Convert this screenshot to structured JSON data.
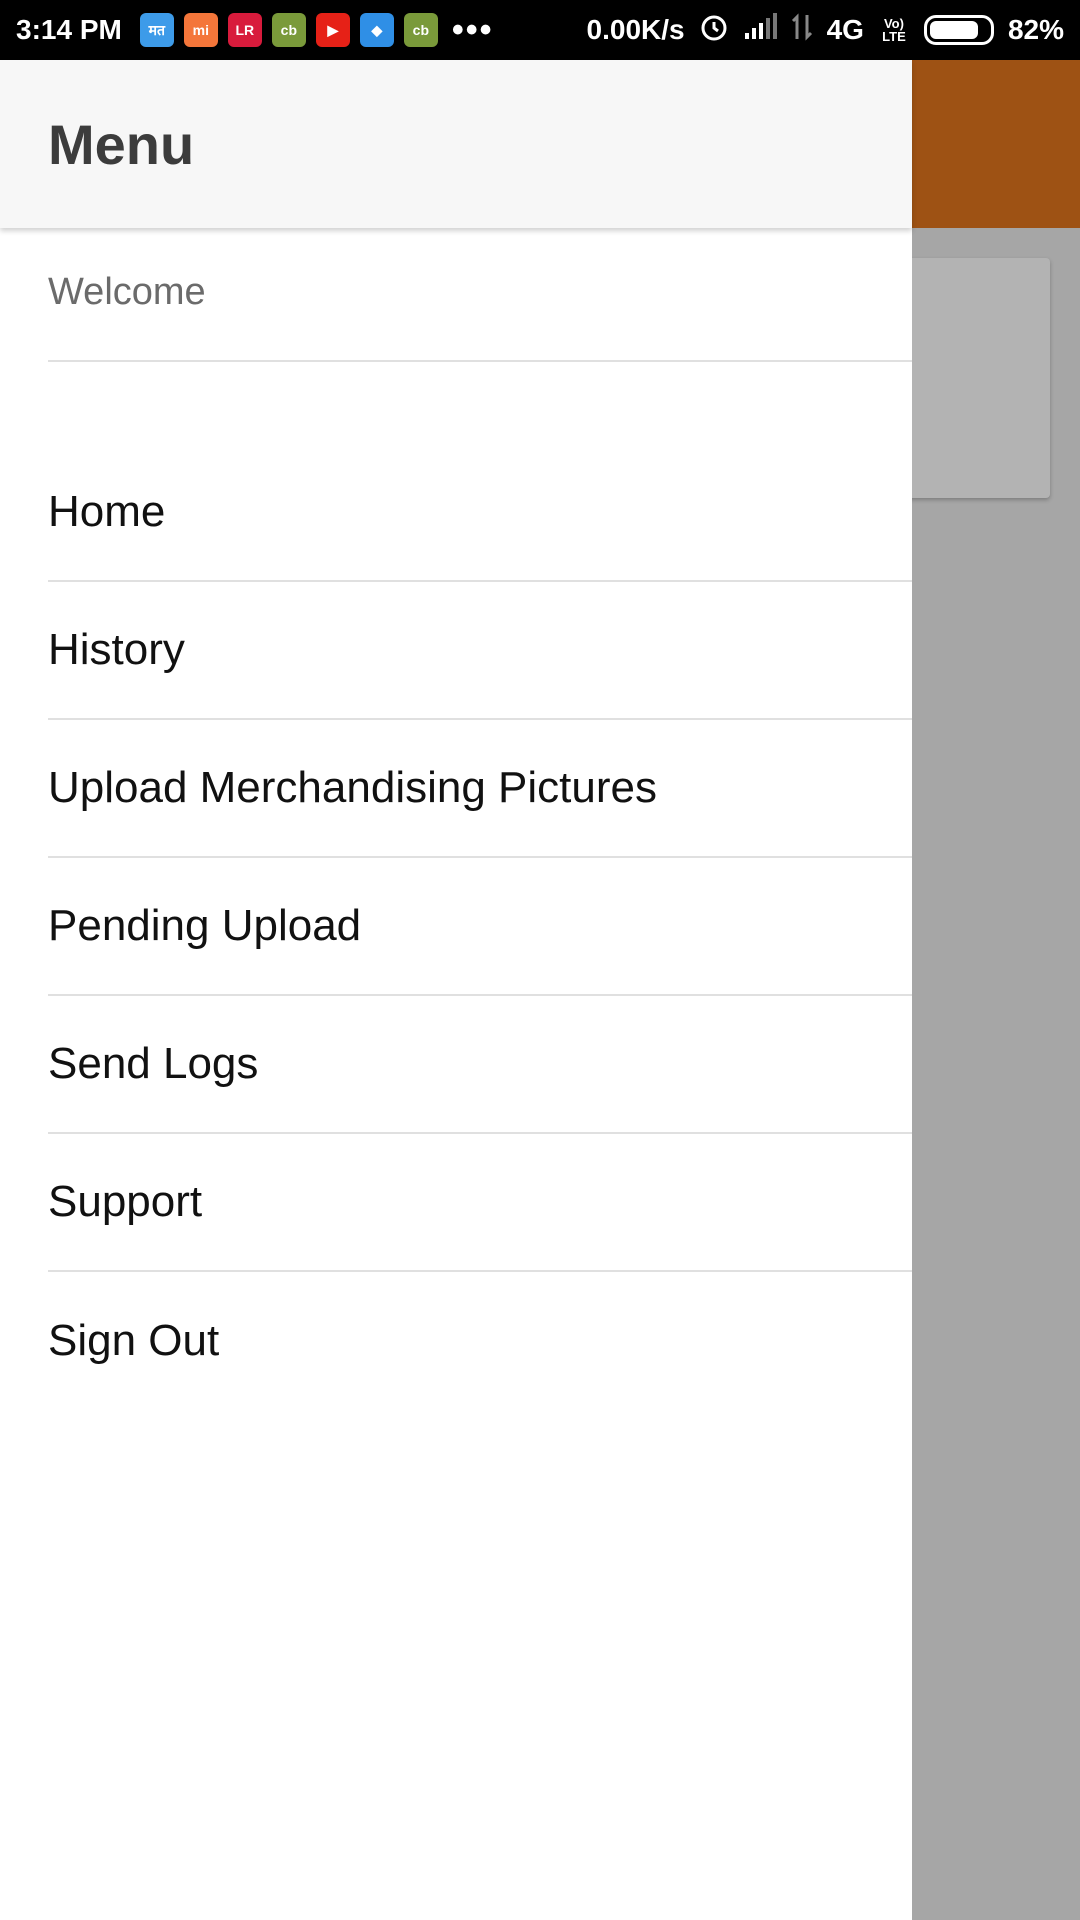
{
  "status_bar": {
    "time": "3:14 PM",
    "notifications": [
      {
        "icon": "news-app-icon",
        "label": "मत",
        "color": "#3d9be9"
      },
      {
        "icon": "shopping-bag-icon",
        "label": "mi",
        "color": "#f4763a"
      },
      {
        "icon": "lr-app-icon",
        "label": "LR",
        "color": "#d81b3c"
      },
      {
        "icon": "cb-app-icon",
        "label": "cb",
        "color": "#7a9a3a"
      },
      {
        "icon": "youtube-icon",
        "label": "▶",
        "color": "#e62117"
      },
      {
        "icon": "message-app-icon",
        "label": "◆",
        "color": "#2f8fe6"
      },
      {
        "icon": "cb-app-icon",
        "label": "cb",
        "color": "#7a9a3a"
      }
    ],
    "more": "•••",
    "net_speed": "0.00K/s",
    "network": "4G",
    "volte": "Vo) LTE",
    "battery_level": 0.82,
    "battery_text": "82%"
  },
  "drawer": {
    "title": "Menu",
    "welcome": "Welcome",
    "items": [
      {
        "label": "Home",
        "name": "menu-item-home"
      },
      {
        "label": "History",
        "name": "menu-item-history"
      },
      {
        "label": "Upload Merchandising Pictures",
        "name": "menu-item-upload-merchandising-pictures"
      },
      {
        "label": "Pending Upload",
        "name": "menu-item-pending-upload"
      },
      {
        "label": "Send Logs",
        "name": "menu-item-send-logs"
      },
      {
        "label": "Support",
        "name": "menu-item-support"
      },
      {
        "label": "Sign Out",
        "name": "menu-item-sign-out"
      }
    ]
  },
  "colors": {
    "app_toolbar": "#9e5214",
    "scrim": "#a6a6a6",
    "drawer_header": "#f7f7f7"
  }
}
